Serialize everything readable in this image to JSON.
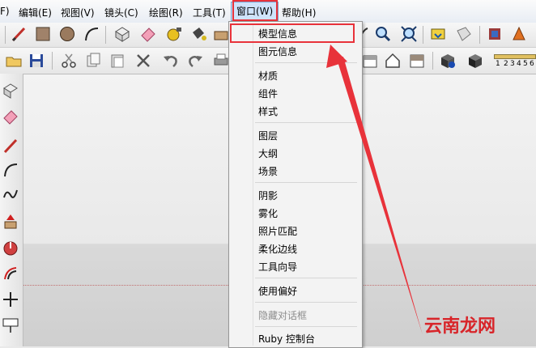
{
  "menubar": {
    "items": [
      {
        "label": "F)"
      },
      {
        "label": "编辑(E)"
      },
      {
        "label": "视图(V)"
      },
      {
        "label": "镜头(C)"
      },
      {
        "label": "绘图(R)"
      },
      {
        "label": "工具(T)"
      },
      {
        "label": "窗口(W)"
      },
      {
        "label": "帮助(H)"
      }
    ]
  },
  "window_menu": {
    "groups": [
      [
        {
          "label": "模型信息"
        },
        {
          "label": "图元信息"
        }
      ],
      [
        {
          "label": "材质"
        },
        {
          "label": "组件"
        },
        {
          "label": "样式"
        }
      ],
      [
        {
          "label": "图层"
        },
        {
          "label": "大纲"
        },
        {
          "label": "场景"
        }
      ],
      [
        {
          "label": "阴影"
        },
        {
          "label": "雾化"
        },
        {
          "label": "照片匹配"
        },
        {
          "label": "柔化边线"
        },
        {
          "label": "工具向导"
        }
      ],
      [
        {
          "label": "使用偏好"
        }
      ],
      [
        {
          "label": "隐藏对话框",
          "disabled": true
        }
      ],
      [
        {
          "label": "Ruby 控制台"
        }
      ]
    ]
  },
  "ruler": {
    "ticks": [
      "1",
      "2",
      "3",
      "4",
      "5",
      "6"
    ]
  },
  "watermark": {
    "text": "云南龙网"
  },
  "colors": {
    "highlight": "#e8323a",
    "menu_active": "#cfe3fb"
  }
}
